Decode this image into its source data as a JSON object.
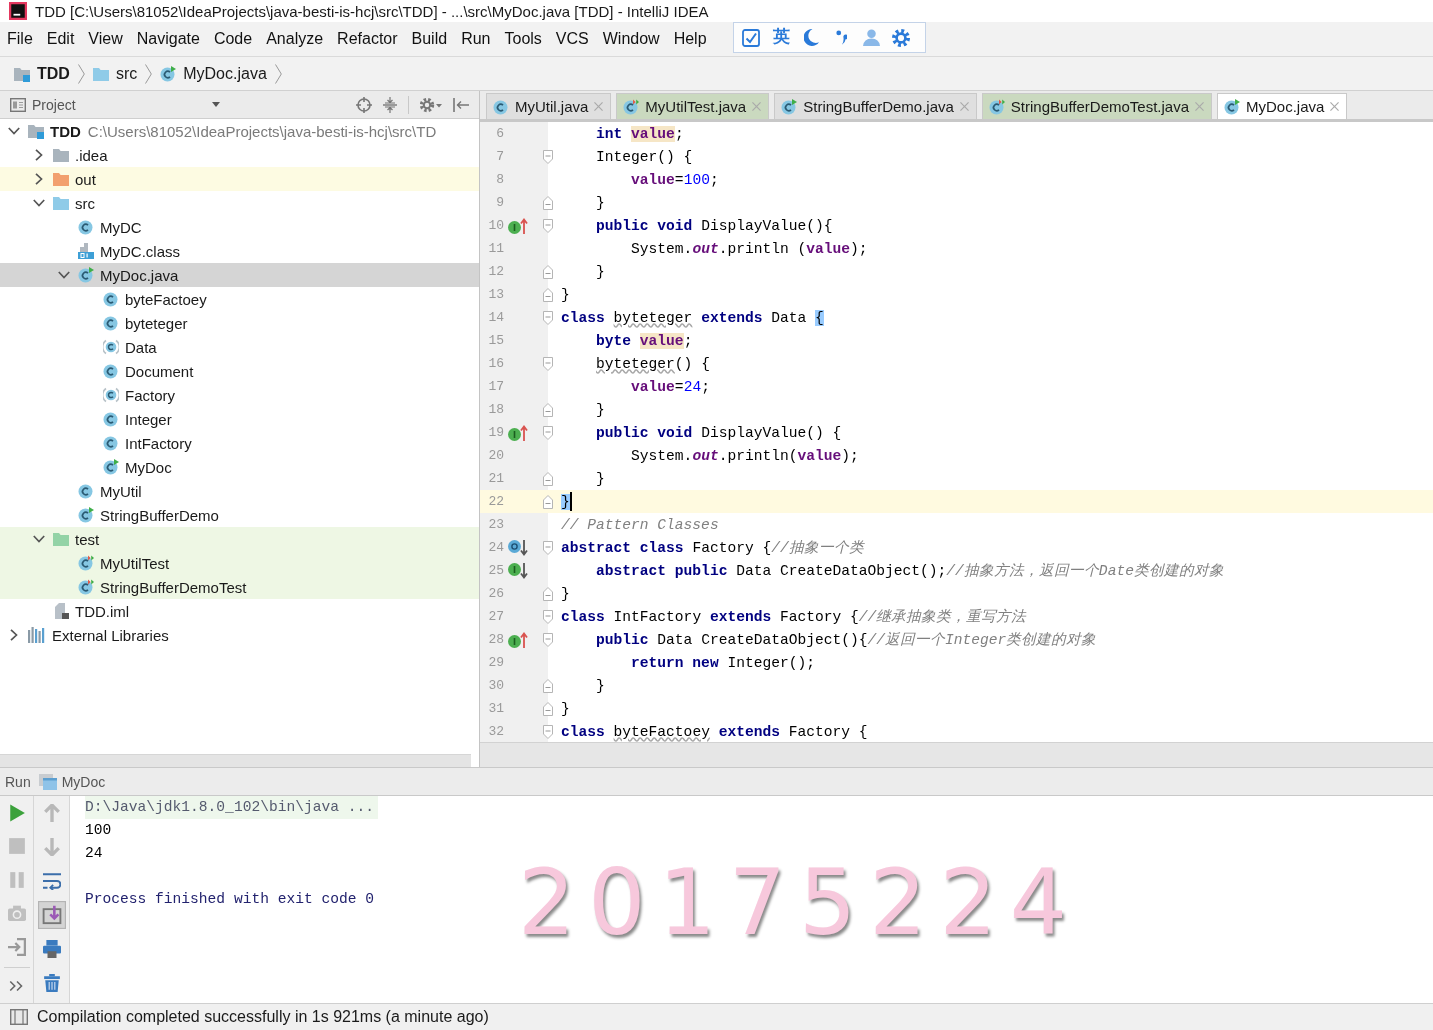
{
  "window": {
    "title": "TDD [C:\\Users\\81052\\IdeaProjects\\java-besti-is-hcj\\src\\TDD] - ...\\src\\MyDoc.java [TDD] - IntelliJ IDEA"
  },
  "menu": [
    "File",
    "Edit",
    "View",
    "Navigate",
    "Code",
    "Analyze",
    "Refactor",
    "Build",
    "Run",
    "Tools",
    "VCS",
    "Window",
    "Help"
  ],
  "ime_toolbar": {
    "mode_label": "英"
  },
  "breadcrumbs": [
    {
      "label": "TDD",
      "kind": "module"
    },
    {
      "label": "src",
      "kind": "source_folder"
    },
    {
      "label": "MyDoc.java",
      "kind": "class_main"
    }
  ],
  "project_panel": {
    "title": "Project",
    "tree": [
      {
        "label": "TDD",
        "kind": "module",
        "path": "C:\\Users\\81052\\IdeaProjects\\java-besti-is-hcj\\src\\TD",
        "expanded": true,
        "selected": false,
        "children": [
          {
            "label": ".idea",
            "kind": "folder",
            "expanded": false,
            "selected": false
          },
          {
            "label": "out",
            "kind": "excluded_folder",
            "expanded": false,
            "selected": false
          },
          {
            "label": "src",
            "kind": "source_folder",
            "expanded": true,
            "selected": false,
            "children": [
              {
                "label": "MyDC",
                "kind": "class",
                "selected": false
              },
              {
                "label": "MyDC.class",
                "kind": "class_file",
                "selected": false
              },
              {
                "label": "MyDoc.java",
                "kind": "class_main",
                "expanded": true,
                "selected": true,
                "children": [
                  {
                    "label": "byteFactoey",
                    "kind": "class",
                    "selected": false
                  },
                  {
                    "label": "byteteger",
                    "kind": "class",
                    "selected": false
                  },
                  {
                    "label": "Data",
                    "kind": "abstract_class",
                    "selected": false
                  },
                  {
                    "label": "Document",
                    "kind": "class",
                    "selected": false
                  },
                  {
                    "label": "Factory",
                    "kind": "abstract_class",
                    "selected": false
                  },
                  {
                    "label": "Integer",
                    "kind": "class",
                    "selected": false
                  },
                  {
                    "label": "IntFactory",
                    "kind": "class",
                    "selected": false
                  },
                  {
                    "label": "MyDoc",
                    "kind": "class_main",
                    "selected": false
                  }
                ]
              },
              {
                "label": "MyUtil",
                "kind": "class",
                "selected": false
              },
              {
                "label": "StringBufferDemo",
                "kind": "class_main",
                "selected": false
              }
            ]
          },
          {
            "label": "test",
            "kind": "test_folder",
            "expanded": true,
            "selected": false,
            "children": [
              {
                "label": "MyUtilTest",
                "kind": "test_class",
                "selected": false
              },
              {
                "label": "StringBufferDemoTest",
                "kind": "test_class",
                "selected": false
              }
            ]
          },
          {
            "label": "TDD.iml",
            "kind": "iml_file",
            "selected": false
          }
        ]
      },
      {
        "label": "External Libraries",
        "kind": "libraries",
        "expanded": false,
        "selected": false
      }
    ]
  },
  "tabs": [
    {
      "label": "MyUtil.java",
      "kind": "class",
      "selected": false
    },
    {
      "label": "MyUtilTest.java",
      "kind": "test_class",
      "selected": false
    },
    {
      "label": "StringBufferDemo.java",
      "kind": "class_main",
      "selected": false
    },
    {
      "label": "StringBufferDemoTest.java",
      "kind": "test_class",
      "selected": false
    },
    {
      "label": "MyDoc.java",
      "kind": "class_main",
      "selected": true
    }
  ],
  "editor": {
    "lines": [
      {
        "number": "6",
        "current": false,
        "tokens": [
          {
            "kind": "kw",
            "text": "    int"
          },
          {
            "kind": "field_hl",
            "text": " value"
          },
          {
            "kind": "plain",
            "text": ";"
          }
        ]
      },
      {
        "number": "7",
        "current": false,
        "fold": {
          "kind": "start"
        },
        "tokens": [
          {
            "kind": "plain",
            "text": "    Integer() {"
          }
        ]
      },
      {
        "number": "8",
        "current": false,
        "tokens": [
          {
            "kind": "field",
            "text": "        value"
          },
          {
            "kind": "plain",
            "text": "="
          },
          {
            "kind": "num",
            "text": "100"
          },
          {
            "kind": "plain",
            "text": ";"
          }
        ]
      },
      {
        "number": "9",
        "current": false,
        "fold": {
          "kind": "end"
        },
        "tokens": [
          {
            "kind": "plain",
            "text": "    }"
          }
        ]
      },
      {
        "number": "10",
        "current": false,
        "marker": {
          "kind": "implements_up"
        },
        "fold": {
          "kind": "start"
        },
        "tokens": [
          {
            "kind": "kw",
            "text": "    public void"
          },
          {
            "kind": "plain",
            "text": " DisplayValue(){"
          }
        ]
      },
      {
        "number": "11",
        "current": false,
        "tokens": [
          {
            "kind": "plain",
            "text": "        System."
          },
          {
            "kind": "static",
            "text": "out"
          },
          {
            "kind": "plain",
            "text": ".println ("
          },
          {
            "kind": "field",
            "text": "value"
          },
          {
            "kind": "plain",
            "text": ");"
          }
        ]
      },
      {
        "number": "12",
        "current": false,
        "fold": {
          "kind": "end"
        },
        "tokens": [
          {
            "kind": "plain",
            "text": "    }"
          }
        ]
      },
      {
        "number": "13",
        "current": false,
        "fold": {
          "kind": "end"
        },
        "tokens": [
          {
            "kind": "plain",
            "text": "}"
          }
        ]
      },
      {
        "number": "14",
        "current": false,
        "fold": {
          "kind": "start"
        },
        "tokens": [
          {
            "kind": "kw",
            "text": "class"
          },
          {
            "kind": "typo",
            "text": " byteteger"
          },
          {
            "kind": "kw",
            "text": " extends"
          },
          {
            "kind": "plain",
            "text": " Data "
          },
          {
            "kind": "brace",
            "text": "{"
          }
        ]
      },
      {
        "number": "15",
        "current": false,
        "tokens": [
          {
            "kind": "kw",
            "text": "    byte"
          },
          {
            "kind": "field_hl",
            "text": " value"
          },
          {
            "kind": "plain",
            "text": ";"
          }
        ]
      },
      {
        "number": "16",
        "current": false,
        "fold": {
          "kind": "start"
        },
        "tokens": [
          {
            "kind": "typo",
            "text": "    byteteger"
          },
          {
            "kind": "plain",
            "text": "() {"
          }
        ]
      },
      {
        "number": "17",
        "current": false,
        "tokens": [
          {
            "kind": "field",
            "text": "        value"
          },
          {
            "kind": "plain",
            "text": "="
          },
          {
            "kind": "num",
            "text": "24"
          },
          {
            "kind": "plain",
            "text": ";"
          }
        ]
      },
      {
        "number": "18",
        "current": false,
        "fold": {
          "kind": "end"
        },
        "tokens": [
          {
            "kind": "plain",
            "text": "    }"
          }
        ]
      },
      {
        "number": "19",
        "current": false,
        "marker": {
          "kind": "implements_up"
        },
        "fold": {
          "kind": "start"
        },
        "tokens": [
          {
            "kind": "kw",
            "text": "    public void"
          },
          {
            "kind": "plain",
            "text": " DisplayValue() {"
          }
        ]
      },
      {
        "number": "20",
        "current": false,
        "tokens": [
          {
            "kind": "plain",
            "text": "        System."
          },
          {
            "kind": "static",
            "text": "out"
          },
          {
            "kind": "plain",
            "text": ".println("
          },
          {
            "kind": "field",
            "text": "value"
          },
          {
            "kind": "plain",
            "text": ");"
          }
        ]
      },
      {
        "number": "21",
        "current": false,
        "fold": {
          "kind": "end"
        },
        "tokens": [
          {
            "kind": "plain",
            "text": "    }"
          }
        ]
      },
      {
        "number": "22",
        "current": true,
        "fold": {
          "kind": "end"
        },
        "tokens": [
          {
            "kind": "brace",
            "text": "}"
          }
        ]
      },
      {
        "number": "23",
        "current": false,
        "tokens": [
          {
            "kind": "comment",
            "text": "// Pattern Classes"
          }
        ]
      },
      {
        "number": "24",
        "current": false,
        "marker": {
          "kind": "overridden_down"
        },
        "fold": {
          "kind": "start"
        },
        "tokens": [
          {
            "kind": "kw",
            "text": "abstract class"
          },
          {
            "kind": "plain",
            "text": " Factory {"
          },
          {
            "kind": "comment",
            "text": "//抽象一个类"
          }
        ]
      },
      {
        "number": "25",
        "current": false,
        "marker": {
          "kind": "implemented_down"
        },
        "tokens": [
          {
            "kind": "kw",
            "text": "    abstract public"
          },
          {
            "kind": "plain",
            "text": " Data CreateDataObject();"
          },
          {
            "kind": "comment",
            "text": "//抽象方法，返回一个Date类创建的对象"
          }
        ]
      },
      {
        "number": "26",
        "current": false,
        "fold": {
          "kind": "end"
        },
        "tokens": [
          {
            "kind": "plain",
            "text": "}"
          }
        ]
      },
      {
        "number": "27",
        "current": false,
        "fold": {
          "kind": "start"
        },
        "tokens": [
          {
            "kind": "kw",
            "text": "class"
          },
          {
            "kind": "plain",
            "text": " IntFactory "
          },
          {
            "kind": "kw",
            "text": "extends"
          },
          {
            "kind": "plain",
            "text": " Factory {"
          },
          {
            "kind": "comment",
            "text": "//继承抽象类，重写方法"
          }
        ]
      },
      {
        "number": "28",
        "current": false,
        "marker": {
          "kind": "implements_up"
        },
        "fold": {
          "kind": "start"
        },
        "tokens": [
          {
            "kind": "kw",
            "text": "    public"
          },
          {
            "kind": "plain",
            "text": " Data CreateDataObject(){"
          },
          {
            "kind": "comment",
            "text": "//返回一个Integer类创建的对象"
          }
        ]
      },
      {
        "number": "29",
        "current": false,
        "tokens": [
          {
            "kind": "kw",
            "text": "        return new"
          },
          {
            "kind": "plain",
            "text": " Integer();"
          }
        ]
      },
      {
        "number": "30",
        "current": false,
        "fold": {
          "kind": "end"
        },
        "tokens": [
          {
            "kind": "plain",
            "text": "    }"
          }
        ]
      },
      {
        "number": "31",
        "current": false,
        "fold": {
          "kind": "end"
        },
        "tokens": [
          {
            "kind": "plain",
            "text": "}"
          }
        ]
      },
      {
        "number": "32",
        "current": false,
        "fold": {
          "kind": "start"
        },
        "tokens": [
          {
            "kind": "kw",
            "text": "class"
          },
          {
            "kind": "typo",
            "text": " byteFactoey"
          },
          {
            "kind": "kw",
            "text": " extends"
          },
          {
            "kind": "plain",
            "text": " Factory {"
          }
        ]
      }
    ]
  },
  "run_panel": {
    "title": "Run",
    "tab": "MyDoc",
    "toolbar_left": [
      {
        "kind": "rerun",
        "disabled": false
      },
      {
        "kind": "stop",
        "disabled": true
      },
      {
        "kind": "pause",
        "disabled": true
      },
      {
        "kind": "dump_threads",
        "disabled": true
      },
      {
        "kind": "exit",
        "disabled": false
      },
      {
        "kind": "more"
      }
    ],
    "toolbar_right": [
      {
        "kind": "up",
        "disabled": true
      },
      {
        "kind": "down",
        "disabled": true
      },
      {
        "kind": "soft_wrap",
        "on": false
      },
      {
        "kind": "scroll_end",
        "on": true
      },
      {
        "kind": "print"
      },
      {
        "kind": "clear"
      }
    ],
    "console": [
      {
        "kind": "command",
        "text": "D:\\Java\\jdk1.8.0_102\\bin\\java ..."
      },
      {
        "kind": "output",
        "text": "100"
      },
      {
        "kind": "output",
        "text": "24"
      },
      {
        "kind": "system",
        "text": "Process finished with exit code 0"
      }
    ]
  },
  "overlay_text": "20175224",
  "status_bar": {
    "message": "Compilation completed successfully in 1s 921ms (a minute ago)"
  }
}
